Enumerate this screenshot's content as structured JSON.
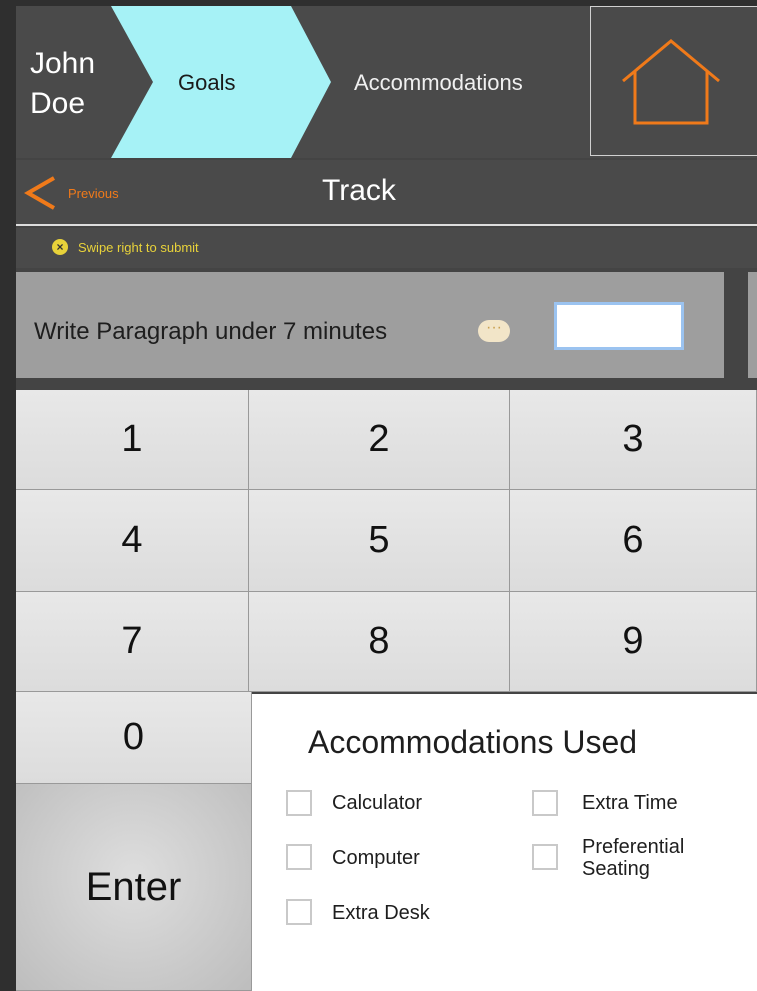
{
  "header": {
    "user_name": "John Doe",
    "goals_label": "Goals",
    "accommodations_label": "Accommodations",
    "home_icon": "home-icon"
  },
  "trackbar": {
    "previous_label": "Previous",
    "title": "Track"
  },
  "hint": {
    "text": "Swipe right to submit",
    "icon": "close-circle-icon"
  },
  "goal": {
    "text": "Write Paragraph under 7 minutes",
    "more_icon": "ellipsis-icon",
    "value": ""
  },
  "keypad": {
    "keys": [
      "1",
      "2",
      "3",
      "4",
      "5",
      "6",
      "7",
      "8",
      "9",
      "0"
    ],
    "enter_label": "Enter"
  },
  "accommodations_panel": {
    "title": "Accommodations Used",
    "options": [
      {
        "label": "Calculator",
        "checked": false
      },
      {
        "label": "Extra Time",
        "checked": false
      },
      {
        "label": "Computer",
        "checked": false
      },
      {
        "label": "Preferential Seating",
        "checked": false
      },
      {
        "label": "Extra Desk",
        "checked": false
      }
    ]
  },
  "colors": {
    "accent_orange": "#f07a1a",
    "goals_chevron": "#a6f2f6",
    "hint_yellow": "#e8d23a"
  }
}
